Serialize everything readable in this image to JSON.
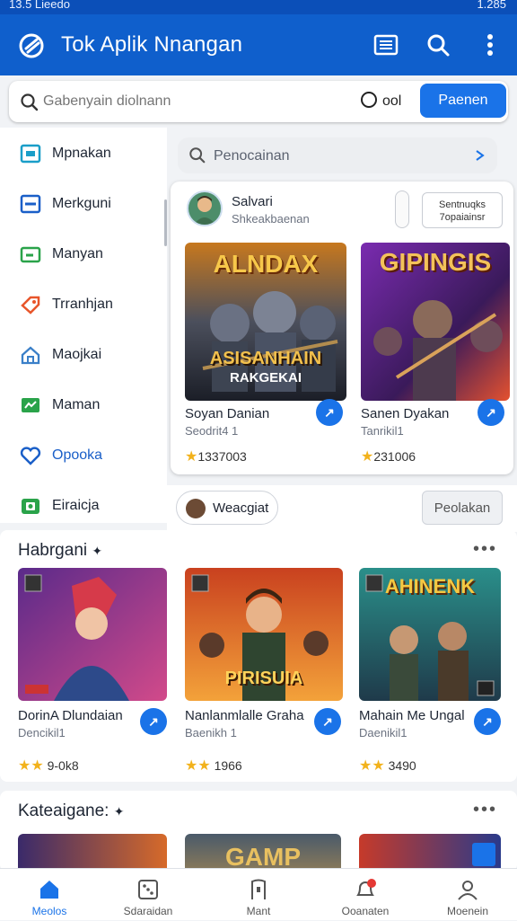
{
  "status": {
    "time": "13.5 Lieedo",
    "right": "1.285"
  },
  "app": {
    "title": "Tok Aplik Nnangan"
  },
  "search": {
    "placeholder": "Gabenyain diolnann",
    "chip_label": "ool",
    "button_label": "Paenen"
  },
  "sidebar": {
    "items": [
      {
        "label": "Mpnakan",
        "icon": "window-icon",
        "color": "#1a9ec8"
      },
      {
        "label": "Merkguni",
        "icon": "card-icon",
        "color": "#1a5fc8"
      },
      {
        "label": "Manyan",
        "icon": "ticket-icon",
        "color": "#2aa34a"
      },
      {
        "label": "Trranhjan",
        "icon": "tag-icon",
        "color": "#e8552a"
      },
      {
        "label": "Maojkai",
        "icon": "home-icon",
        "color": "#3a7fc8"
      },
      {
        "label": "Maman",
        "icon": "map-icon",
        "color": "#2aa34a"
      },
      {
        "label": "Opooka",
        "icon": "heart-icon",
        "color": "#1a5fc8"
      },
      {
        "label": "Eiraicja",
        "icon": "camera-icon",
        "color": "#2aa34a"
      }
    ]
  },
  "panel": {
    "search_placeholder": "Penocainan",
    "user": {
      "name": "Salvari",
      "subtitle": "Shkeakbaenan"
    },
    "side_button": {
      "line1": "Sentnuqks",
      "line2": "7opaiainsr"
    },
    "games": [
      {
        "banner_top": "ALNDAX",
        "banner_bottom": "ASISANHAIN",
        "banner_bottom2": "RAKGEKAI",
        "name": "Soyan Danian",
        "subtitle": "Seodrit4 1",
        "rating": "1337003"
      },
      {
        "banner_top": "GIPINGIS",
        "name": "Sanen Dyakan",
        "subtitle": "Tanrikil1",
        "rating": "231006"
      }
    ]
  },
  "pill_row": {
    "pill_label": "Weacgiat",
    "button_label": "Peolakan"
  },
  "section1": {
    "title": "Habrgani",
    "games": [
      {
        "name": "DorinA Dlundaian",
        "subtitle": "Dencikil1",
        "rating": "9-0k8"
      },
      {
        "name": "Nanlanmlalle Graha",
        "banner": "PIRISUIA",
        "subtitle": "Baenikh 1",
        "rating": "1966"
      },
      {
        "name": "Mahain Me Ungal",
        "banner": "AHINENK",
        "subtitle": "Daenikil1",
        "rating": "3490"
      }
    ]
  },
  "section2": {
    "title": "Kateaigane:",
    "banner": "GAMP"
  },
  "bottom_nav": [
    {
      "label": "Meolos",
      "icon": "home-icon",
      "active": true
    },
    {
      "label": "Sdaraidan",
      "icon": "dice-icon"
    },
    {
      "label": "Mant",
      "icon": "door-icon"
    },
    {
      "label": "Ooanaten",
      "icon": "bell-icon"
    },
    {
      "label": "Moenein",
      "icon": "profile-icon"
    }
  ],
  "colors": {
    "primary": "#0f5fcc",
    "accent": "#1a73e8",
    "star": "#f2b21c"
  }
}
